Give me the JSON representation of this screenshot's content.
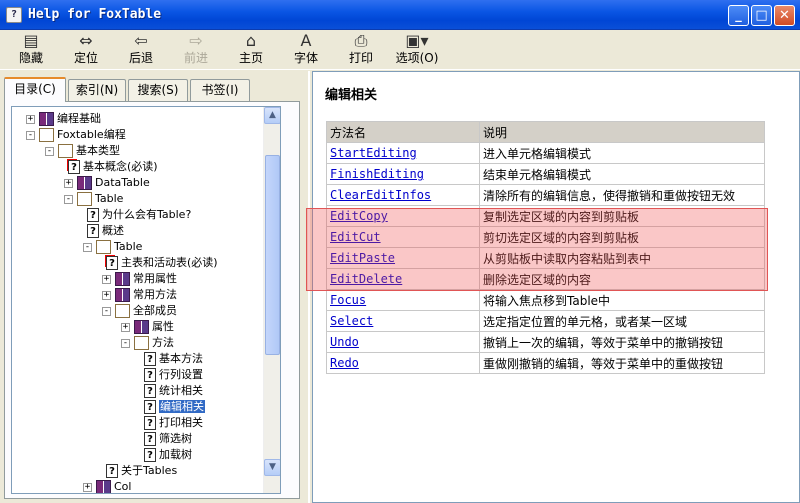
{
  "window": {
    "title": "Help for FoxTable"
  },
  "colors": {
    "titlebar": "#0a56e4",
    "link": "#0000cc",
    "selection": "#316ac5",
    "highlight": "#f05050"
  },
  "toolbar": {
    "buttons": [
      {
        "label": "隐藏",
        "icon": "hide-icon"
      },
      {
        "label": "定位",
        "icon": "locate-icon"
      },
      {
        "label": "后退",
        "icon": "back-arrow-icon"
      },
      {
        "label": "前进",
        "icon": "forward-arrow-icon",
        "disabled": true
      },
      {
        "label": "主页",
        "icon": "home-icon"
      },
      {
        "label": "字体",
        "icon": "font-icon"
      },
      {
        "label": "打印",
        "icon": "print-icon"
      },
      {
        "label": "选项(O)",
        "icon": "options-icon"
      }
    ]
  },
  "tabs": [
    "目录(C)",
    "索引(N)",
    "搜索(S)",
    "书签(I)"
  ],
  "tree": [
    {
      "label": "编程基础",
      "icon": "book",
      "exp": "+"
    },
    {
      "label": "Foxtable编程",
      "icon": "bookopen",
      "exp": "−"
    },
    {
      "label": "基本类型",
      "icon": "bookopen",
      "exp": "−"
    },
    {
      "label": "基本概念(必读)",
      "icon": "pagestar"
    },
    {
      "label": "DataTable",
      "icon": "book",
      "exp": "+"
    },
    {
      "label": "Table",
      "icon": "bookopen",
      "exp": "−"
    },
    {
      "label": "为什么会有Table?",
      "icon": "page"
    },
    {
      "label": "概述",
      "icon": "page"
    },
    {
      "label": "Table",
      "icon": "bookopen",
      "exp": "−"
    },
    {
      "label": "主表和活动表(必读)",
      "icon": "pagestar"
    },
    {
      "label": "常用属性",
      "icon": "book",
      "exp": "+"
    },
    {
      "label": "常用方法",
      "icon": "book",
      "exp": "+"
    },
    {
      "label": "全部成员",
      "icon": "bookopen",
      "exp": "−"
    },
    {
      "label": "属性",
      "icon": "book",
      "exp": "+"
    },
    {
      "label": "方法",
      "icon": "bookopen",
      "exp": "−"
    },
    {
      "label": "基本方法",
      "icon": "page"
    },
    {
      "label": "行列设置",
      "icon": "page"
    },
    {
      "label": "统计相关",
      "icon": "page"
    },
    {
      "label": "编辑相关",
      "icon": "page",
      "selected": true
    },
    {
      "label": "打印相关",
      "icon": "page"
    },
    {
      "label": "筛选树",
      "icon": "page"
    },
    {
      "label": "加载树",
      "icon": "page"
    },
    {
      "label": "关于Tables",
      "icon": "page"
    },
    {
      "label": "Col",
      "icon": "book",
      "exp": "+"
    }
  ],
  "content": {
    "title": "编辑相关",
    "headers": [
      "方法名",
      "说明"
    ],
    "rows": [
      {
        "method": "StartEditing",
        "desc": "进入单元格编辑模式"
      },
      {
        "method": "FinishEditing",
        "desc": "结束单元格编辑模式"
      },
      {
        "method": "ClearEditInfos",
        "desc": "清除所有的编辑信息，使得撤销和重做按钮无效"
      },
      {
        "method": "EditCopy",
        "desc": "复制选定区域的内容到剪贴板"
      },
      {
        "method": "EditCut",
        "desc": "剪切选定区域的内容到剪贴板"
      },
      {
        "method": "EditPaste",
        "desc": "从剪贴板中读取内容粘贴到表中"
      },
      {
        "method": "EditDelete",
        "desc": "删除选定区域的内容"
      },
      {
        "method": "Focus",
        "desc": "将输入焦点移到Table中"
      },
      {
        "method": "Select",
        "desc": "选定指定位置的单元格，或者某一区域"
      },
      {
        "method": "Undo",
        "desc": "撤销上一次的编辑，等效于菜单中的撤销按钮"
      },
      {
        "method": "Redo",
        "desc": "重做刚撤销的编辑，等效于菜单中的重做按钮"
      }
    ]
  }
}
